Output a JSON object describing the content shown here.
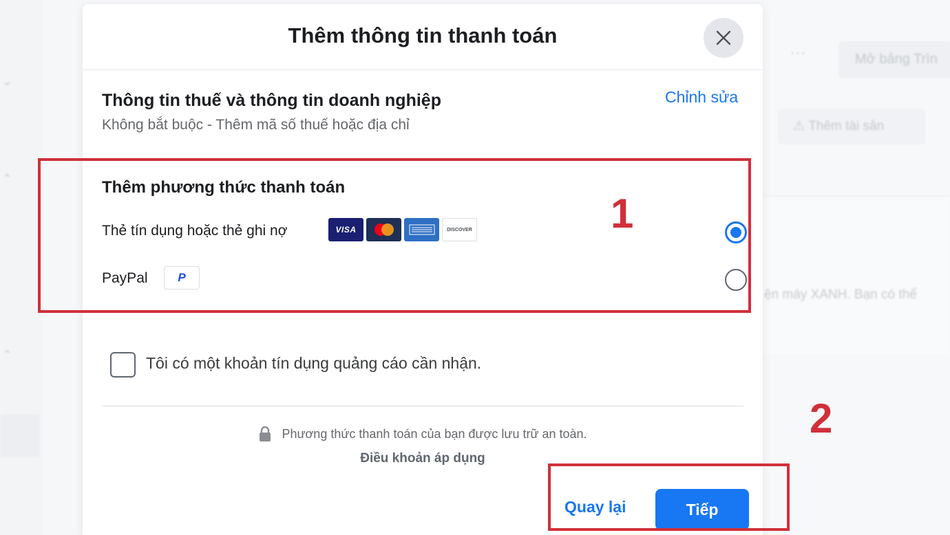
{
  "background": {
    "menu_dots": "···",
    "open_button_label": "Mở bảng Trìn",
    "add_asset_label": "Thêm tài sản",
    "text_snippet": "ện máy XANH. Bạn có thể"
  },
  "modal": {
    "title": "Thêm thông tin thanh toán",
    "close_icon": "close-icon",
    "tax_section": {
      "title": "Thông tin thuế và thông tin doanh nghiệp",
      "subtitle": "Không bắt buộc - Thêm mã số thuế hoặc địa chỉ",
      "edit_link": "Chỉnh sửa"
    },
    "payment_section": {
      "title": "Thêm phương thức thanh toán",
      "options": [
        {
          "label": "Thẻ tín dụng hoặc thẻ ghi nợ",
          "selected": true,
          "logos": [
            "VISA",
            "mastercard",
            "AMERICAN EXPRESS",
            "DISCOVER"
          ]
        },
        {
          "label": "PayPal",
          "selected": false,
          "logo": "P"
        }
      ]
    },
    "ad_credit_checkbox": {
      "label": "Tôi có một khoản tín dụng quảng cáo cần nhận.",
      "checked": false
    },
    "security_note": "Phương thức thanh toán của bạn được lưu trữ an toàn.",
    "terms_link": "Điều khoản áp dụng",
    "back_button": "Quay lại",
    "next_button": "Tiếp"
  },
  "annotations": {
    "step1_number": "1",
    "step2_number": "2",
    "color": "#d0303a"
  },
  "colors": {
    "accent": "#1877f2",
    "annotation": "#d0303a"
  }
}
